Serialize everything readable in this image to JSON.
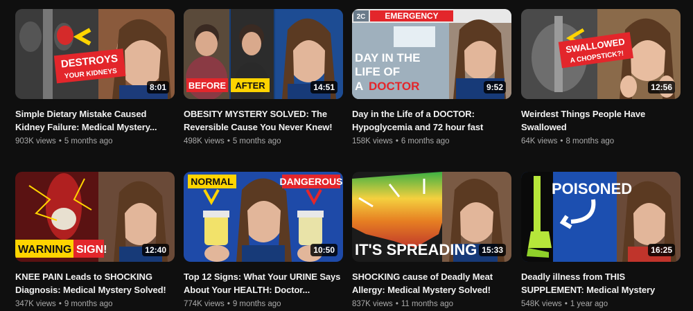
{
  "videos": [
    {
      "title": "Simple Dietary Mistake Caused Kidney Failure: Medical Mystery...",
      "views": "903K views",
      "age": "5 months ago",
      "duration": "8:01",
      "thumb_text": [
        "DESTROYS",
        "YOUR KIDNEYS"
      ]
    },
    {
      "title": "OBESITY MYSTERY SOLVED: The Reversible Cause You Never Knew!",
      "views": "498K views",
      "age": "5 months ago",
      "duration": "14:51",
      "thumb_text": [
        "BEFORE",
        "AFTER"
      ]
    },
    {
      "title": "Day in the Life of a DOCTOR: Hypoglycemia and 72 hour fast",
      "views": "158K views",
      "age": "6 months ago",
      "duration": "9:52",
      "thumb_text": [
        "EMERGENCY",
        "DAY IN THE",
        "LIFE OF",
        "A",
        "DOCTOR",
        "2C"
      ]
    },
    {
      "title": "Weirdest Things People Have Swallowed",
      "views": "64K views",
      "age": "8 months ago",
      "duration": "12:56",
      "thumb_text": [
        "SWALLOWED",
        "A CHOPSTICK?!"
      ]
    },
    {
      "title": "KNEE PAIN Leads to SHOCKING Diagnosis: Medical Mystery Solved!",
      "views": "347K views",
      "age": "9 months ago",
      "duration": "12:40",
      "thumb_text": [
        "WARNING",
        "SIGN!"
      ]
    },
    {
      "title": "Top 12 Signs: What Your URINE Says About Your HEALTH: Doctor...",
      "views": "774K views",
      "age": "9 months ago",
      "duration": "10:50",
      "thumb_text": [
        "NORMAL",
        "DANGEROUS"
      ]
    },
    {
      "title": "SHOCKING cause of Deadly Meat Allergy: Medical Mystery Solved!",
      "views": "837K views",
      "age": "11 months ago",
      "duration": "15:33",
      "thumb_text": [
        "IT'S SPREADING"
      ]
    },
    {
      "title": "Deadly illness from THIS SUPPLEMENT: Medical Mystery",
      "views": "548K views",
      "age": "1 year ago",
      "duration": "16:25",
      "thumb_text": [
        "POISONED"
      ]
    }
  ],
  "separator": "•",
  "colors": {
    "background": "#0f0f0f",
    "title": "#f1f1f1",
    "meta": "#aaaaaa",
    "badge_red": "#e3262b",
    "badge_yellow": "#ffd400"
  }
}
